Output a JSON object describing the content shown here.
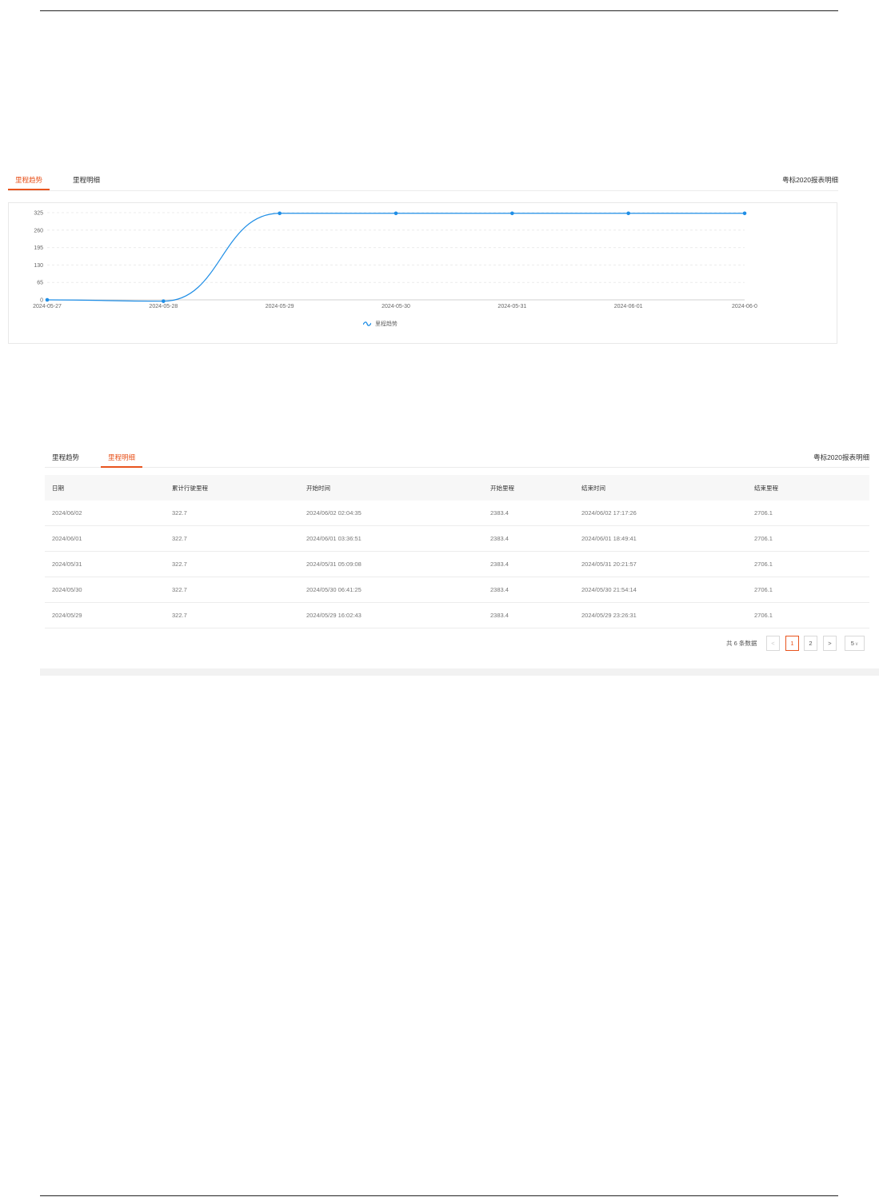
{
  "trend_panel": {
    "tabs": [
      {
        "label": "里程趋势",
        "active": true
      },
      {
        "label": "里程明细",
        "active": false
      }
    ],
    "right_link": "粤标2020报表明细"
  },
  "chart_data": {
    "type": "line",
    "x": [
      "2024-05-27",
      "2024-05-28",
      "2024-05-29",
      "2024-05-30",
      "2024-05-31",
      "2024-06-01",
      "2024-06-02"
    ],
    "x_tick_labels": [
      "2024-05-27",
      "2024-05-28",
      "2024-05-29",
      "2024-05-30",
      "2024-05-31",
      "2024-06-01",
      "2024-06-0"
    ],
    "series": [
      {
        "name": "里程趋势",
        "values": [
          0,
          -5,
          322.7,
          322.7,
          322.7,
          322.7,
          322.7
        ],
        "color": "#1f8ee6",
        "smooth": true
      }
    ],
    "yticks": [
      0,
      65,
      130,
      195,
      260,
      325
    ],
    "ylim": [
      0,
      325
    ],
    "grid": "horizontal dashed",
    "legend": "bottom-center"
  },
  "detail_panel": {
    "tabs": [
      {
        "label": "里程趋势",
        "active": false
      },
      {
        "label": "里程明细",
        "active": true
      }
    ],
    "right_link": "粤标2020报表明细",
    "columns": [
      "日期",
      "累计行驶里程",
      "开始时间",
      "开始里程",
      "结束时间",
      "结束里程"
    ],
    "rows": [
      [
        "2024/06/02",
        "322.7",
        "2024/06/02 02:04:35",
        "2383.4",
        "2024/06/02 17:17:26",
        "2706.1"
      ],
      [
        "2024/06/01",
        "322.7",
        "2024/06/01 03:36:51",
        "2383.4",
        "2024/06/01 18:49:41",
        "2706.1"
      ],
      [
        "2024/05/31",
        "322.7",
        "2024/05/31 05:09:08",
        "2383.4",
        "2024/05/31 20:21:57",
        "2706.1"
      ],
      [
        "2024/05/30",
        "322.7",
        "2024/05/30 06:41:25",
        "2383.4",
        "2024/05/30 21:54:14",
        "2706.1"
      ],
      [
        "2024/05/29",
        "322.7",
        "2024/05/29 16:02:43",
        "2383.4",
        "2024/05/29 23:26:31",
        "2706.1"
      ]
    ],
    "pagination": {
      "total_text": "共 6 条数据",
      "prev": "<",
      "pages": [
        "1",
        "2"
      ],
      "current": "1",
      "next": ">",
      "page_size": "5",
      "page_size_icon": "chevron-down-icon"
    }
  }
}
